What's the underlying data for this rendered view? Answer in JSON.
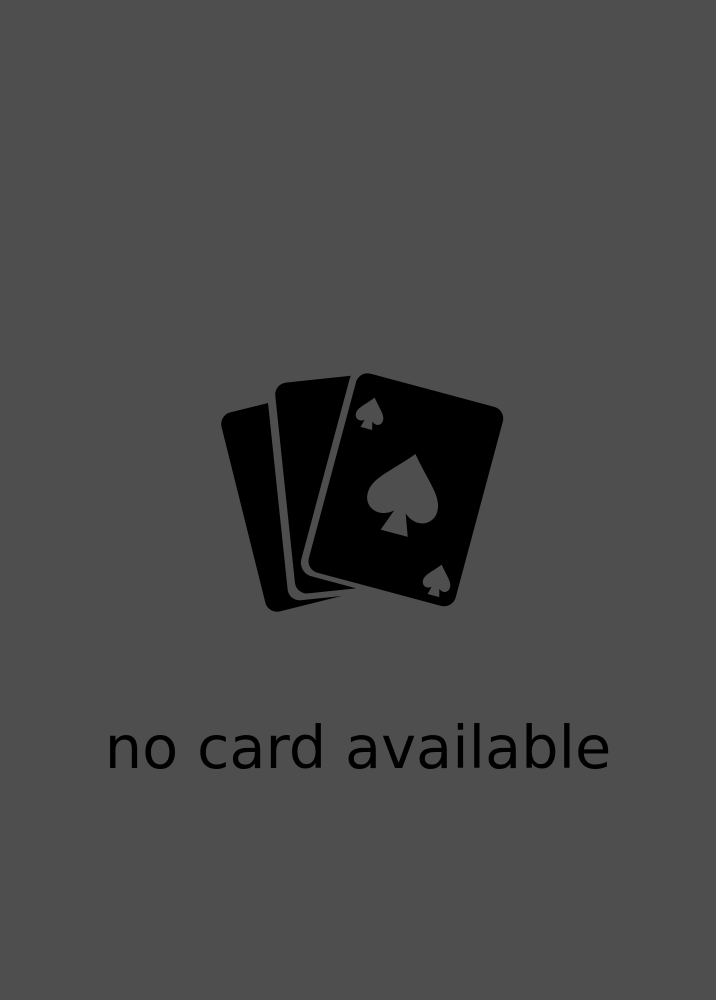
{
  "placeholder": {
    "icon": "playing-cards-icon",
    "message": "no card available",
    "background_color": "#4e4e4e",
    "text_color": "#000000"
  }
}
